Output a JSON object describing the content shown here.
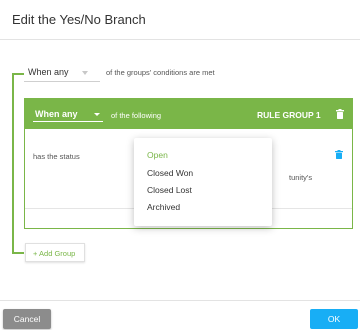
{
  "dialog": {
    "title": "Edit the Yes/No Branch"
  },
  "outer_condition": {
    "selected": "When any",
    "suffix": "of the groups' conditions are met"
  },
  "rule_group": {
    "selected": "When any",
    "suffix": "of the following",
    "title": "RULE GROUP 1",
    "rule": {
      "field": "has the status",
      "value_partial": "tunity's"
    }
  },
  "status_dropdown": {
    "options": [
      {
        "label": "Open",
        "selected": true
      },
      {
        "label": "Closed Won",
        "selected": false
      },
      {
        "label": "Closed Lost",
        "selected": false
      },
      {
        "label": "Archived",
        "selected": false
      }
    ]
  },
  "add_group": {
    "label": "+ Add Group"
  },
  "footer": {
    "cancel_label": "Cancel",
    "ok_label": "OK"
  },
  "colors": {
    "accent_green": "#7ab648",
    "ok_blue": "#18aef5",
    "cancel_gray": "#8c8c8c"
  },
  "icons": {
    "trash": "trash-icon",
    "caret": "chevron-down-icon"
  }
}
